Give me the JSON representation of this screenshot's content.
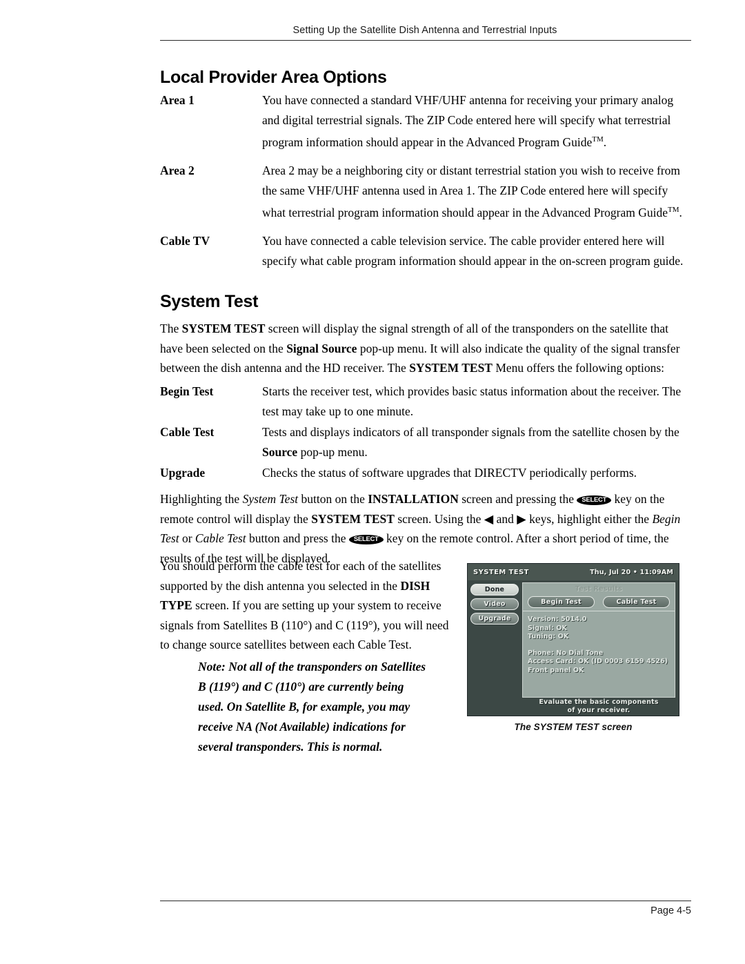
{
  "header": {
    "running_head": "Setting Up the Satellite Dish Antenna and Terrestrial Inputs"
  },
  "sections": {
    "local_provider": {
      "title": "Local Provider Area Options",
      "items": [
        {
          "term": "Area 1",
          "description": "You have connected a standard VHF/UHF antenna for receiving your primary analog and digital terrestrial signals. The ZIP Code entered here will specify what terrestrial program information should appear in the Advanced Program Guide",
          "trademark": "TM",
          "tail": "."
        },
        {
          "term": "Area 2",
          "description": "Area 2 may be a neighboring city or distant terrestrial station you wish to receive from the same VHF/UHF antenna used in Area 1. The ZIP Code entered here will specify what terrestrial program information should appear in the Advanced Program Guide",
          "trademark": "TM",
          "tail": "."
        },
        {
          "term": "Cable TV",
          "description": "You have connected a cable television service. The cable provider entered here will specify what cable program information should appear in the on-screen program guide.",
          "trademark": "",
          "tail": ""
        }
      ]
    },
    "system_test": {
      "title": "System Test",
      "intro": {
        "p1": "The ",
        "b1": "SYSTEM TEST",
        "p2": " screen will display the signal strength of all of the transponders on the satellite that have been selected on the ",
        "b2": "Signal Source",
        "p3": " pop-up menu. It will also indicate the quality of the signal transfer between the dish antenna and the HD receiver. The ",
        "b3": "SYSTEM TEST",
        "p4": " Menu offers the following options:"
      },
      "items": [
        {
          "term": "Begin Test",
          "description": "Starts the receiver test, which provides basic status information about the receiver. The test may take up to one minute."
        },
        {
          "term": "Cable Test",
          "description_pre": "Tests and displays indicators of all transponder signals from the satellite chosen by the ",
          "description_bold": "Source",
          "description_post": " pop-up menu."
        },
        {
          "term": "Upgrade",
          "description": "Checks the status of software upgrades that DIRECTV periodically performs."
        }
      ],
      "instructions": {
        "t1": "Highlighting the ",
        "i1": "System Test",
        "t2": " button on the ",
        "b1": "INSTALLATION",
        "t3": " screen and pressing the ",
        "key1": "SELECT",
        "t4": " key on the remote control will display the ",
        "b2": "SYSTEM TEST",
        "t5": " screen. Using the ",
        "arrow_left": "◀",
        "t6": " and ",
        "arrow_right": "▶",
        "t7": " keys, highlight either the ",
        "i2": "Begin Test",
        "t8": " or ",
        "i3": "Cable Test",
        "t9": " button and press the ",
        "key2": "SELECT",
        "t10": " key on the remote control. After a short period of time, the results of the test will be displayed."
      },
      "cable_test_advice": {
        "t1": "You should perform the cable test for each of the satellites supported by the dish antenna you selected in the ",
        "b1": "DISH TYPE",
        "t2": " screen. If you are setting up your system to receive signals from Satellites B (110°) and C (119°), you will need to change source satellites between each Cable Test."
      },
      "note_lines": [
        "Note: Not all of the transponders on Satellites",
        "B (119°) and C (110°) are currently being",
        "used. On Satellite B, for example, you may",
        "receive NA (Not Available) indications for",
        "several transponders. This is normal."
      ]
    }
  },
  "figure": {
    "caption": "The SYSTEM TEST screen",
    "screen": {
      "title": "SYSTEM TEST",
      "clock": "Thu, Jul 20 • 11:09AM",
      "nav_buttons": [
        {
          "label": "Done",
          "selected": true
        },
        {
          "label": "Video",
          "selected": false
        },
        {
          "label": "Upgrade",
          "selected": false
        }
      ],
      "panel_title": "Test Results",
      "tabs": [
        {
          "label": "Begin Test"
        },
        {
          "label": "Cable Test"
        }
      ],
      "results_group_1": [
        "Version: 5014.0",
        "Signal: OK",
        "Tuning: OK"
      ],
      "results_group_2": [
        "Phone: No Dial Tone",
        "Access Card: OK (ID 0003 6159 4526)",
        "Front panel OK"
      ],
      "footer_line_1": "Evaluate the basic components",
      "footer_line_2": "of your receiver."
    },
    "colors": {
      "screen_bg": "#3c4845",
      "panel_bg": "#9aa8a2",
      "topbar_bg": "#4a5651"
    }
  },
  "footer": {
    "page_label": "Page 4-5"
  }
}
